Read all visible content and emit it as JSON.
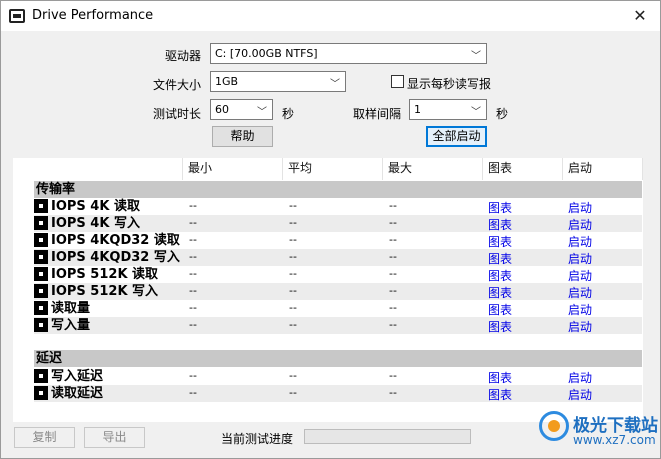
{
  "window": {
    "title": "Drive Performance"
  },
  "settings": {
    "drive_label": "驱动器",
    "drive_value": "C: [70.00GB NTFS]",
    "filesize_label": "文件大小",
    "filesize_value": "1GB",
    "show_rw_label": "显示每秒读写报",
    "duration_label": "测试时长",
    "duration_value": "60",
    "duration_unit": "秒",
    "interval_label": "取样间隔",
    "interval_value": "1",
    "interval_unit": "秒",
    "help_button": "帮助",
    "start_all_button": "全部启动"
  },
  "table": {
    "headers": [
      "最小",
      "平均",
      "最大",
      "图表",
      "启动"
    ],
    "sections": [
      {
        "title": "传输率",
        "rows": [
          {
            "name": "IOPS 4K 读取",
            "min": "--",
            "avg": "--",
            "max": "--",
            "chart": "图表",
            "start": "启动"
          },
          {
            "name": "IOPS 4K 写入",
            "min": "--",
            "avg": "--",
            "max": "--",
            "chart": "图表",
            "start": "启动"
          },
          {
            "name": "IOPS 4KQD32 读取",
            "min": "--",
            "avg": "--",
            "max": "--",
            "chart": "图表",
            "start": "启动"
          },
          {
            "name": "IOPS 4KQD32 写入",
            "min": "--",
            "avg": "--",
            "max": "--",
            "chart": "图表",
            "start": "启动"
          },
          {
            "name": "IOPS 512K 读取",
            "min": "--",
            "avg": "--",
            "max": "--",
            "chart": "图表",
            "start": "启动"
          },
          {
            "name": "IOPS 512K 写入",
            "min": "--",
            "avg": "--",
            "max": "--",
            "chart": "图表",
            "start": "启动"
          },
          {
            "name": "读取量",
            "min": "--",
            "avg": "--",
            "max": "--",
            "chart": "图表",
            "start": "启动"
          },
          {
            "name": "写入量",
            "min": "--",
            "avg": "--",
            "max": "--",
            "chart": "图表",
            "start": "启动"
          }
        ]
      },
      {
        "title": "延迟",
        "rows": [
          {
            "name": "写入延迟",
            "min": "--",
            "avg": "--",
            "max": "--",
            "chart": "图表",
            "start": "启动"
          },
          {
            "name": "读取延迟",
            "min": "--",
            "avg": "--",
            "max": "--",
            "chart": "图表",
            "start": "启动"
          }
        ]
      }
    ]
  },
  "footer": {
    "copy_button": "复制",
    "export_button": "导出",
    "progress_label": "当前测试进度",
    "progress_value": 0
  },
  "watermark": {
    "text": "极光下载站",
    "url": "www.xz7.com"
  }
}
